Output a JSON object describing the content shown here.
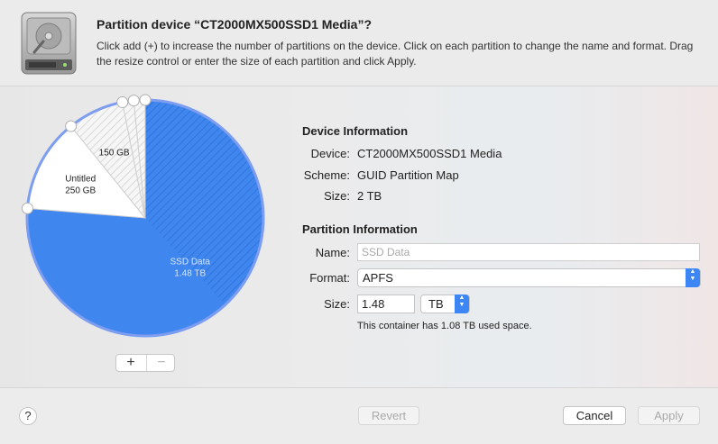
{
  "dialog": {
    "title": "Partition device “CT2000MX500SSD1 Media”?",
    "description": "Click add (+) to increase the number of partitions on the device. Click on each partition to change the name and format. Drag the resize control or enter the size of each partition and click Apply."
  },
  "pie_chart": {
    "partitions": [
      {
        "name": "SSD Data",
        "size": "1.48 TB",
        "value": 1.48,
        "color": "#3f86ef",
        "selected": true
      },
      {
        "name": "Untitled",
        "size": "250 GB",
        "value": 0.25,
        "color": "#ffffff",
        "selected": false
      },
      {
        "name": "",
        "size": "150 GB",
        "value": 0.15,
        "color": "#f4f4f4",
        "selected": false
      },
      {
        "name": "",
        "size": "",
        "value": 0.03,
        "color": "#f4f4f4",
        "selected": false
      },
      {
        "name": "",
        "size": "",
        "value": 0.03,
        "color": "#f4f4f4",
        "selected": false
      }
    ],
    "add_label": "+",
    "remove_label": "−"
  },
  "device_info": {
    "heading": "Device Information",
    "device_label": "Device:",
    "device_value": "CT2000MX500SSD1 Media",
    "scheme_label": "Scheme:",
    "scheme_value": "GUID Partition Map",
    "size_label": "Size:",
    "size_value": "2 TB"
  },
  "partition_info": {
    "heading": "Partition Information",
    "name_label": "Name:",
    "name_placeholder": "SSD Data",
    "format_label": "Format:",
    "format_value": "APFS",
    "size_label": "Size:",
    "size_value": "1.48",
    "size_unit": "TB",
    "note": "This container has 1.08 TB used space."
  },
  "footer": {
    "help_label": "?",
    "revert_label": "Revert",
    "cancel_label": "Cancel",
    "apply_label": "Apply"
  }
}
